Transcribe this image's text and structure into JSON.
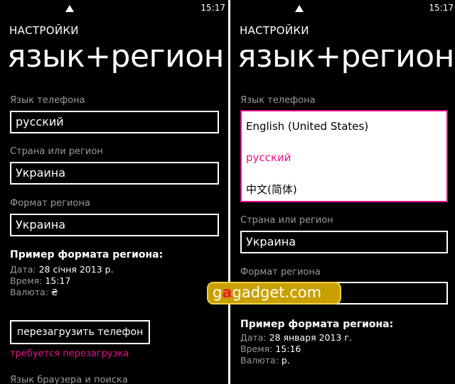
{
  "left": {
    "status": {
      "time": "15:17"
    },
    "header": {
      "app_title": "НАСТРОЙКИ",
      "page_title": "язык+регион"
    },
    "phone_language": {
      "label": "Язык телефона",
      "value": "русский"
    },
    "country": {
      "label": "Страна или регион",
      "value": "Украина"
    },
    "region_format": {
      "label": "Формат региона",
      "value": "Украина"
    },
    "example": {
      "heading": "Пример формата региона:",
      "date_label": "Дата:",
      "date_value": "28 січня 2013 р.",
      "time_label": "Время:",
      "time_value": "15:17",
      "currency_label": "Валюта:",
      "currency_value": "₴"
    },
    "restart_button": "перезагрузить телефон",
    "restart_notice": "требуется перезагрузка",
    "browser_language_label": "Язык браузера и поиска"
  },
  "right": {
    "status": {
      "time": "15:17"
    },
    "header": {
      "app_title": "НАСТРОЙКИ",
      "page_title": "язык+регион"
    },
    "phone_language": {
      "label": "Язык телефона",
      "options": [
        "English (United States)",
        "русский",
        "中文(简体)"
      ],
      "selected_index": 1
    },
    "country": {
      "label": "Страна или регион",
      "value": "Украина"
    },
    "region_format": {
      "label": "Формат региона"
    },
    "example": {
      "heading": "Пример формата региона:",
      "date_label": "Дата:",
      "date_value": "28 января 2013 г.",
      "time_label": "Время:",
      "time_value": "15:16",
      "currency_label": "Валюта:",
      "currency_value": "р."
    }
  },
  "watermark": {
    "before": "g",
    "accent": "a",
    "after": "gadget.com"
  },
  "colors": {
    "accent": "#e2148a",
    "label_gray": "#9a9a9a",
    "watermark": "#c8a000"
  }
}
